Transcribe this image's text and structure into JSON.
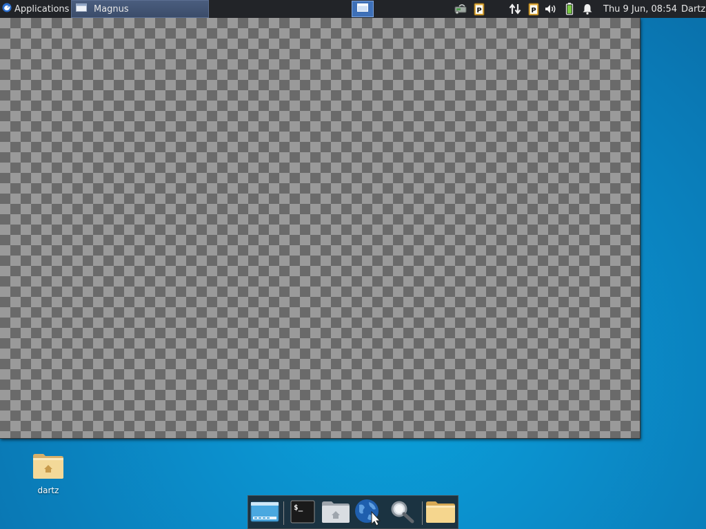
{
  "top_panel": {
    "applications_label": "Applications",
    "active_window_title": "Magnus",
    "clock": "Thu  9 Jun, 08:54",
    "user": "Dartz",
    "tray_icons": [
      "network-removable-icon",
      "clipboard-parcellite-icon",
      "network-transfer-icon",
      "clipboard-parcellite-icon",
      "volume-icon",
      "battery-icon",
      "notification-bell-icon"
    ]
  },
  "window": {
    "app": "Magnus",
    "content": "transparency-checkerboard"
  },
  "desktop_icons": [
    {
      "label": "dartz",
      "icon": "home-folder-icon"
    }
  ],
  "dock": {
    "items": [
      "show-desktop-icon",
      "terminal-icon",
      "home-folder-icon",
      "web-browser-icon",
      "search-icon",
      "folder-icon"
    ]
  },
  "colors": {
    "panel": "#222428",
    "desktop": "#0a8fcc",
    "checker_dark": "#6a6a6a",
    "checker_light": "#9a9a9a",
    "taskbar_active": "#3b4c6a"
  }
}
